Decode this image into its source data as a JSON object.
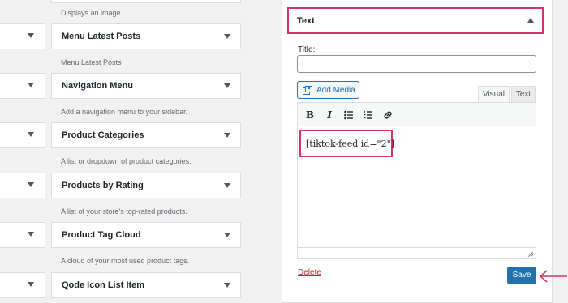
{
  "available_widgets": [
    {
      "title": "",
      "description": "Displays an image."
    },
    {
      "title": "Menu Latest Posts",
      "description": "Menu Latest Posts"
    },
    {
      "title": "Navigation Menu",
      "description": "Add a navigation menu to your sidebar."
    },
    {
      "title": "Product Categories",
      "description": "A list or dropdown of product categories."
    },
    {
      "title": "Products by Rating",
      "description": "A list of your store's top-rated products."
    },
    {
      "title": "Product Tag Cloud",
      "description": "A cloud of your most used product tags."
    },
    {
      "title": "Qode Icon List Item",
      "description": ""
    }
  ],
  "text_widget": {
    "header_title": "Text",
    "title_label": "Title:",
    "title_value": "",
    "add_media_label": "Add Media",
    "tab_visual": "Visual",
    "tab_text": "Text",
    "toolbar": {
      "bold": "B",
      "italic": "I"
    },
    "content": "[tiktok-feed id=\"2\"]",
    "delete_label": "Delete",
    "save_label": "Save"
  },
  "colors": {
    "highlight": "#d6336c",
    "primary": "#2271b1",
    "delete": "#b32d2e"
  }
}
